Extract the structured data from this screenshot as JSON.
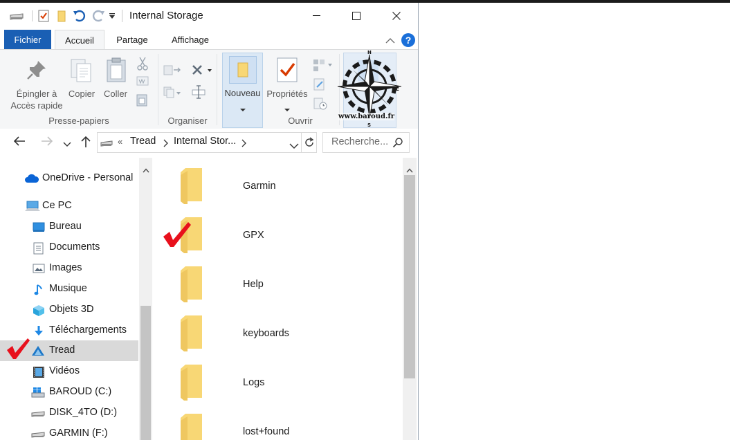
{
  "window": {
    "title": "Internal Storage"
  },
  "ribbon": {
    "tabs": [
      {
        "label": "Fichier"
      },
      {
        "label": "Accueil"
      },
      {
        "label": "Partage"
      },
      {
        "label": "Affichage"
      }
    ],
    "pin": {
      "line1": "Épingler à",
      "line2": "Accès rapide"
    },
    "copy": "Copier",
    "paste": "Coller",
    "group_clipboard": "Presse-papiers",
    "group_organize": "Organiser",
    "new": "Nouveau",
    "properties": "Propriétés",
    "group_open": "Ouvrir"
  },
  "watermark": {
    "site": "www.baroud.fr"
  },
  "address": {
    "overflow": "«",
    "crumbs": [
      "Tread",
      "Internal Stor..."
    ],
    "search_placeholder": "Recherche..."
  },
  "nav": {
    "items": [
      {
        "label": "OneDrive - Personal",
        "icon": "onedrive-icon"
      },
      {
        "label": "Ce PC",
        "icon": "this-pc-icon"
      },
      {
        "label": "Bureau",
        "icon": "desktop-icon"
      },
      {
        "label": "Documents",
        "icon": "documents-icon"
      },
      {
        "label": "Images",
        "icon": "images-icon"
      },
      {
        "label": "Musique",
        "icon": "music-icon"
      },
      {
        "label": "Objets 3D",
        "icon": "objects-3d-icon"
      },
      {
        "label": "Téléchargements",
        "icon": "downloads-icon"
      },
      {
        "label": "Tread",
        "icon": "tread-device-icon",
        "selected": true
      },
      {
        "label": "Vidéos",
        "icon": "videos-icon"
      },
      {
        "label": "BAROUD (C:)",
        "icon": "windows-drive-icon"
      },
      {
        "label": "DISK_4TO (D:)",
        "icon": "drive-icon"
      },
      {
        "label": "GARMIN (F:)",
        "icon": "drive-icon"
      }
    ]
  },
  "files": {
    "folders": [
      {
        "name": "Garmin"
      },
      {
        "name": "GPX",
        "checked": true
      },
      {
        "name": "Help"
      },
      {
        "name": "keyboards"
      },
      {
        "name": "Logs"
      },
      {
        "name": "lost+found"
      }
    ]
  },
  "colors": {
    "accent": "#1a5fb4",
    "folder": "#f8d775",
    "checkmark": "#e8101c",
    "selection": "#d9d9d9"
  }
}
